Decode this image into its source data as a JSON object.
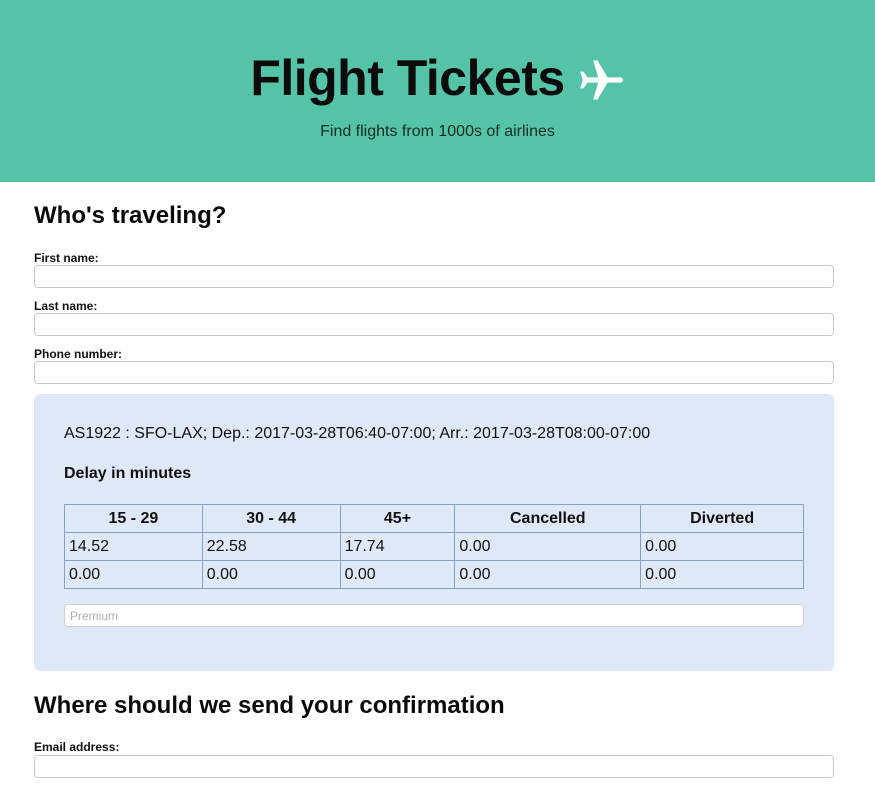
{
  "header": {
    "title": "Flight Tickets",
    "subtitle": "Find flights from 1000s of airlines",
    "icon": "airplane-icon",
    "background_color": "#55c4a6"
  },
  "traveler": {
    "heading": "Who's traveling?",
    "first_name_label": "First name:",
    "first_name_value": "",
    "last_name_label": "Last name:",
    "last_name_value": "",
    "phone_label": "Phone number:",
    "phone_value": ""
  },
  "flight": {
    "info": "AS1922 : SFO-LAX; Dep.: 2017-03-28T06:40-07:00; Arr.: 2017-03-28T08:00-07:00",
    "delay_heading": "Delay in minutes",
    "card_color": "#dfe8f6",
    "table": {
      "headers": [
        "15 - 29",
        "30 - 44",
        "45+",
        "Cancelled",
        "Diverted"
      ],
      "rows": [
        [
          "14.52",
          "22.58",
          "17.74",
          "0.00",
          "0.00"
        ],
        [
          "0.00",
          "0.00",
          "0.00",
          "0.00",
          "0.00"
        ]
      ]
    },
    "premium_placeholder": "Premium",
    "premium_value": ""
  },
  "confirmation": {
    "heading": "Where should we send your confirmation",
    "email_label": "Email address:",
    "email_value": ""
  }
}
